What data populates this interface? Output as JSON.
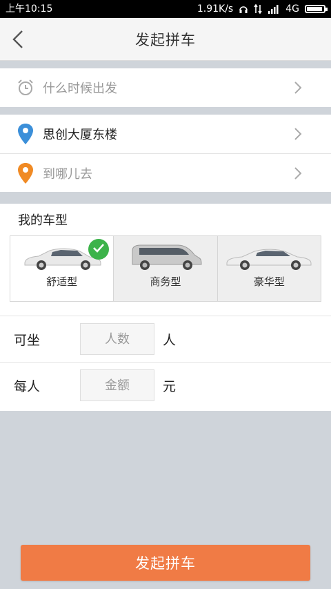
{
  "statusbar": {
    "time": "上午10:15",
    "speed": "1.91K/s",
    "network": "4G"
  },
  "header": {
    "title": "发起拼车",
    "back_icon": "chevron-left-icon"
  },
  "departure": {
    "placeholder": "什么时候出发",
    "icon": "alarm-clock-icon"
  },
  "route": {
    "origin": "思创大厦东楼",
    "origin_icon": "map-pin-icon",
    "origin_color": "#3b8fd9",
    "destination_placeholder": "到哪儿去",
    "destination_icon": "map-pin-icon",
    "destination_color": "#f08a24"
  },
  "car_types": {
    "title": "我的车型",
    "options": [
      {
        "label": "舒适型",
        "selected": true
      },
      {
        "label": "商务型",
        "selected": false
      },
      {
        "label": "豪华型",
        "selected": false
      }
    ],
    "check_color": "#3cb34a"
  },
  "seats": {
    "label": "可坐",
    "placeholder": "人数",
    "unit": "人"
  },
  "price": {
    "label": "每人",
    "placeholder": "金额",
    "unit": "元"
  },
  "submit": {
    "label": "发起拼车",
    "color": "#f07b45"
  }
}
